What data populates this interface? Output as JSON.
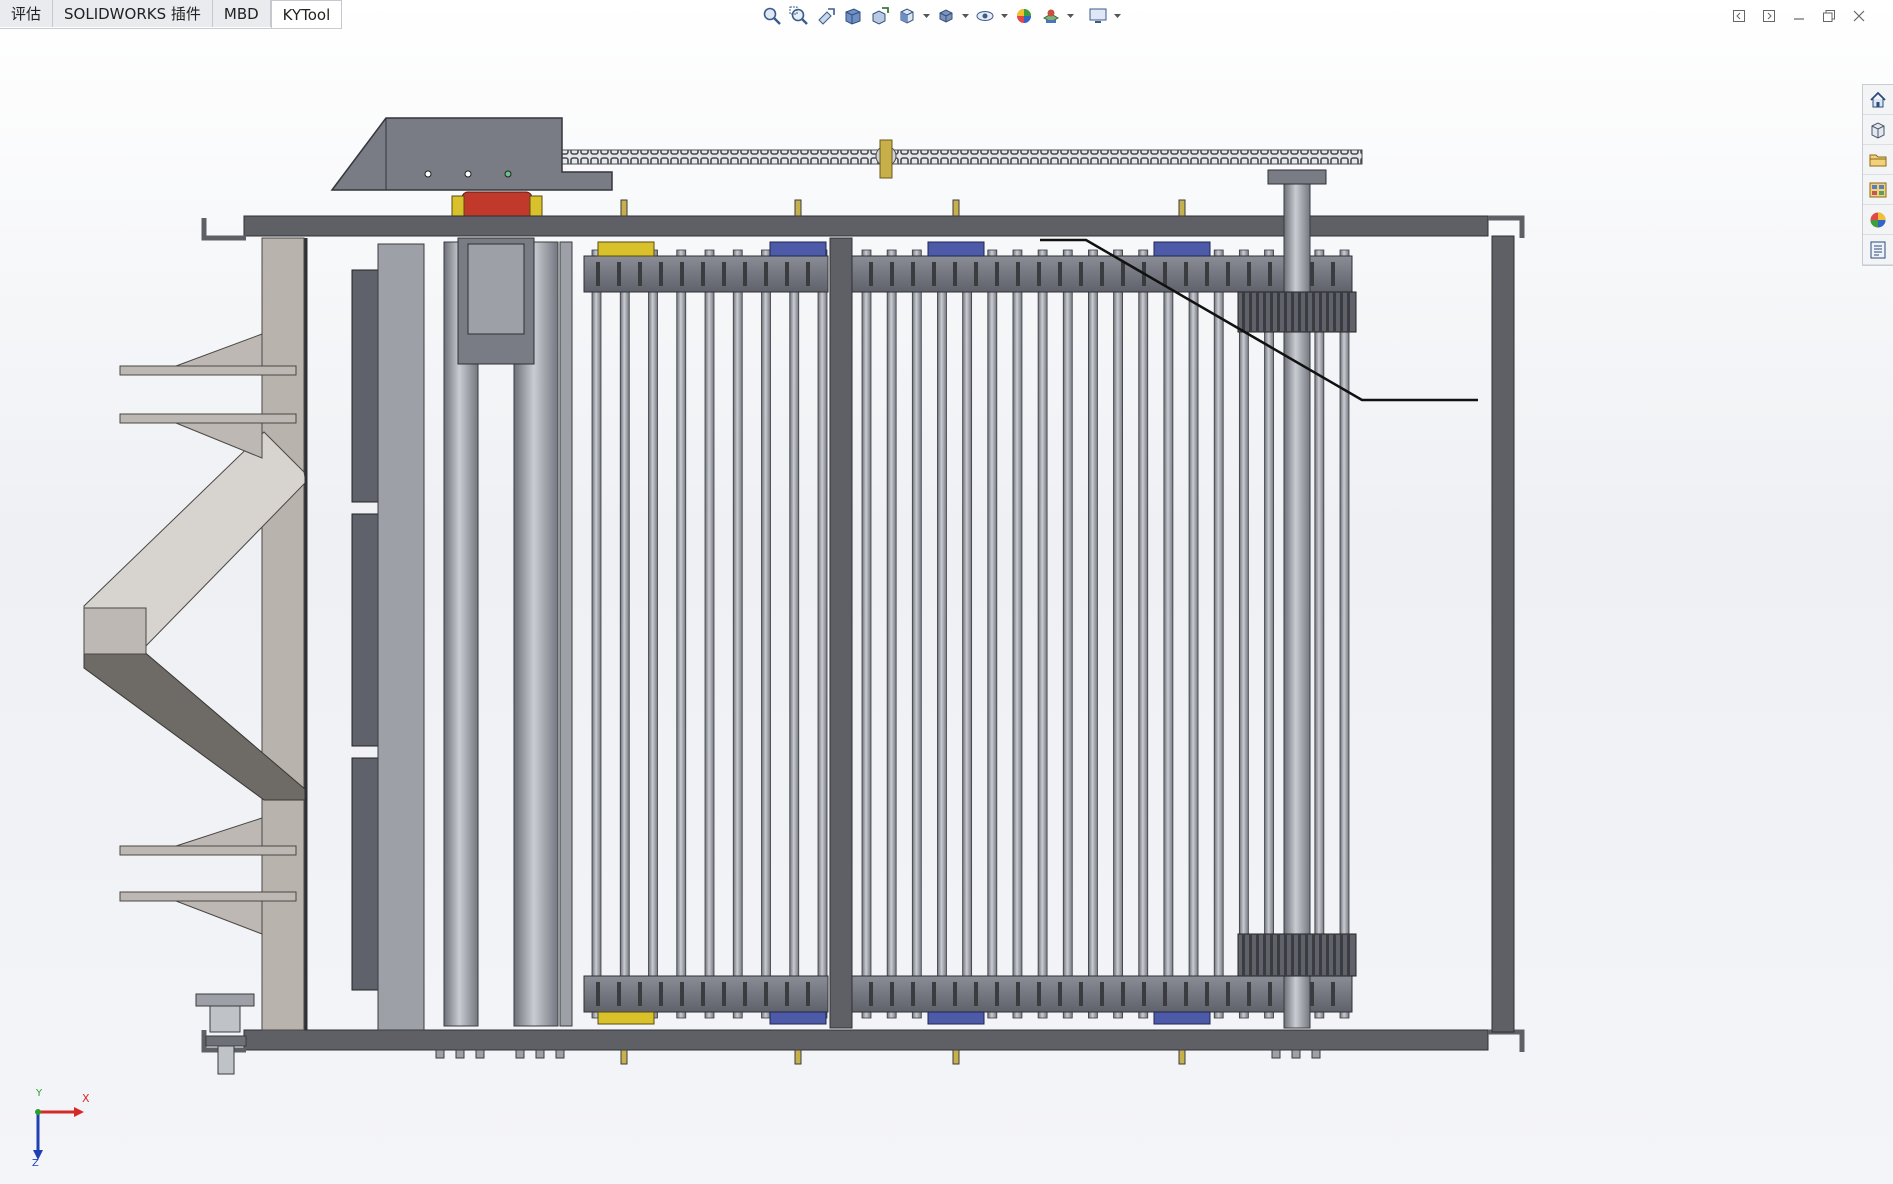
{
  "command_manager": {
    "tabs": [
      {
        "label": "评估"
      },
      {
        "label": "SOLIDWORKS 插件"
      },
      {
        "label": "MBD"
      },
      {
        "label": "KYTool"
      }
    ]
  },
  "heads_up_toolbar": {
    "buttons": [
      {
        "icon": "zoom-to-fit-icon"
      },
      {
        "icon": "zoom-to-area-icon"
      },
      {
        "icon": "previous-view-icon"
      },
      {
        "icon": "section-view-icon"
      },
      {
        "icon": "dynamic-annotation-view-icon"
      },
      {
        "icon": "view-orientation-icon"
      },
      {
        "icon": "display-style-icon"
      },
      {
        "icon": "hide-show-items-icon"
      },
      {
        "icon": "edit-appearance-icon"
      },
      {
        "icon": "apply-scene-icon"
      },
      {
        "icon": "view-settings-icon"
      }
    ]
  },
  "window_controls": {
    "buttons": [
      {
        "icon": "restore-left-icon"
      },
      {
        "icon": "restore-right-icon"
      },
      {
        "icon": "minimize-icon"
      },
      {
        "icon": "maximize-icon"
      },
      {
        "icon": "close-icon"
      }
    ]
  },
  "task_pane": {
    "items": [
      {
        "icon": "home-icon"
      },
      {
        "icon": "design-library-icon"
      },
      {
        "icon": "file-explorer-icon"
      },
      {
        "icon": "view-palette-icon"
      },
      {
        "icon": "appearances-icon"
      },
      {
        "icon": "custom-properties-icon"
      }
    ]
  },
  "viewport": {
    "model": "conveyor-frame-assembly-top-view",
    "colors": {
      "frame": "#5e6066",
      "frame_light": "#7b7e85",
      "bracket_panel": "#b8b3ad",
      "chute_dark": "#6e6a65",
      "roller_plate": "#73767f",
      "roller_tube": "#9da0a6",
      "motor_housing": "#7a7c85",
      "motor_red": "#c0392b",
      "sprocket_blue": "#4c5aa8",
      "sprocket_yellow": "#d8c12a",
      "chain": "#4a4c52",
      "background_top": "#ffffff",
      "background_mid": "#eef0f4"
    }
  },
  "triad": {
    "x_label": "X",
    "y_label": "Y",
    "z_label": "Z",
    "colors": {
      "x": "#d62828",
      "y": "#2aa02a",
      "z": "#1f3fb5"
    }
  }
}
